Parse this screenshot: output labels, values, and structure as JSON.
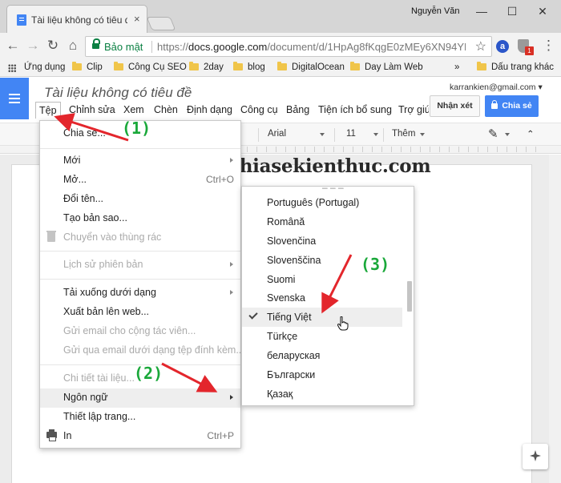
{
  "browser": {
    "tab_title": "Tài liệu không có tiêu đề",
    "tab_close": "×",
    "profile_name": "Nguyễn Văn",
    "window_controls": {
      "minimize": "—",
      "maximize": "☐",
      "close": "✕"
    },
    "nav": {
      "back": "←",
      "forward": "→",
      "reload": "↻",
      "home": "⌂"
    },
    "secure_label": "Bảo mật",
    "url_scheme": "https://",
    "url_host": "docs.google.com",
    "url_path": "/document/d/1HpAg8fKqgE0zMEy6XN94YM...",
    "star": "☆",
    "menu_dots": "⋮",
    "ext_a": "a",
    "ext_badge": "1",
    "bookmarks": [
      "Ứng dụng",
      "Clip",
      "Công Cụ SEO",
      "2day",
      "blog",
      "DigitalOcean",
      "Day Làm Web"
    ],
    "bookmarks_more": "»",
    "bookmarks_other": "Dấu trang khác"
  },
  "docs": {
    "title": "Tài liệu không có tiêu đề",
    "account": "karrankien@gmail.com",
    "account_caret": "▾",
    "menus": [
      "Tệp",
      "Chỉnh sửa",
      "Xem",
      "Chèn",
      "Định dạng",
      "Công cụ",
      "Bảng",
      "Tiện ích bổ sung",
      "Trợ giúp"
    ],
    "comments_button": "Nhận xét",
    "share_button": "Chia sẻ",
    "toolbar": {
      "font": "Arial",
      "size": "11",
      "more": "Thêm",
      "pen": "✎",
      "collapse": "⌃"
    }
  },
  "watermark": "blogchiasekienthuc.com",
  "file_menu": {
    "share": "Chia sẻ...",
    "new": "Mới",
    "open": "Mở...",
    "open_shortcut": "Ctrl+O",
    "rename": "Đổi tên...",
    "make_copy": "Tạo bản sao...",
    "move_trash": "Chuyển vào thùng rác",
    "version_history": "Lịch sử phiên bản",
    "download_as": "Tải xuống dưới dạng",
    "publish": "Xuất bản lên web...",
    "email_collaborators": "Gửi email cho cộng tác viên...",
    "email_attachment": "Gửi qua email dưới dạng tệp đính kèm...",
    "details": "Chi tiết tài liệu...",
    "language": "Ngôn ngữ",
    "page_setup": "Thiết lập trang...",
    "print": "In",
    "print_shortcut": "Ctrl+P"
  },
  "language_menu": {
    "items": [
      "Português (Portugal)",
      "Română",
      "Slovenčina",
      "Slovenščina",
      "Suomi",
      "Svenska",
      "Tiếng Việt",
      "Türkçe",
      "беларуская",
      "Български",
      "Қазақ"
    ],
    "selected": "Tiếng Việt"
  },
  "annotations": {
    "step1": "(1)",
    "step2": "(2)",
    "step3": "(3)",
    "arrow_color": "#e3262c",
    "label_color": "#1aa83a"
  },
  "colors": {
    "docs_blue": "#4285f4",
    "secure_green": "#0b8043"
  }
}
